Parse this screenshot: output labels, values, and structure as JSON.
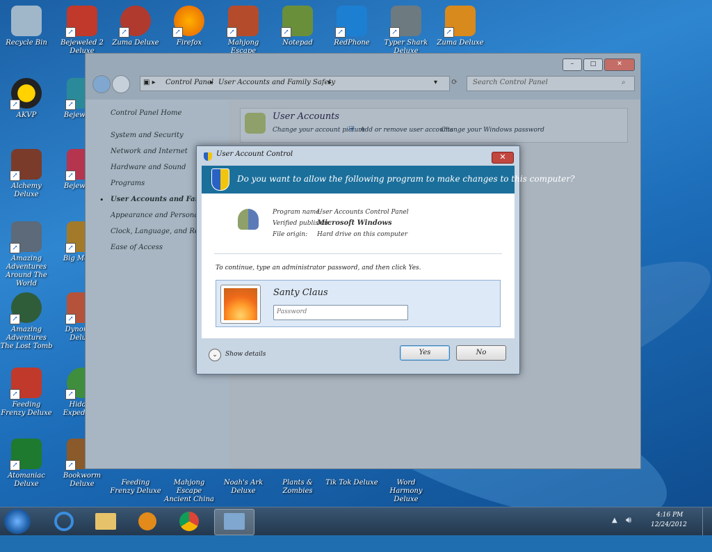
{
  "desktop": {
    "icons": [
      {
        "label": "Recycle Bin",
        "color": "#9fb7c9",
        "shortcut": false
      },
      {
        "label": "Bejeweled 2 Deluxe",
        "color": "#c0392b",
        "shortcut": true
      },
      {
        "label": "Zuma Deluxe",
        "color": "#b03a2e",
        "shortcut": true
      },
      {
        "label": "Firefox",
        "color": "#e66000",
        "shortcut": true
      },
      {
        "label": "Mahjong Escape",
        "color": "#b44c2c",
        "shortcut": true
      },
      {
        "label": "Notepad",
        "color": "#6a8f3a",
        "shortcut": true
      },
      {
        "label": "RedPhone",
        "color": "#1d7fd1",
        "shortcut": true
      },
      {
        "label": "Typer Shark Deluxe",
        "color": "#6d7a80",
        "shortcut": true
      },
      {
        "label": "Zuma Deluxe",
        "color": "#d88a1c",
        "shortcut": true
      },
      {
        "label": "AKVP",
        "color": "#222222",
        "shortcut": true
      },
      {
        "label": "Bejeweled",
        "color": "#2b8a99",
        "shortcut": true
      },
      {
        "label": "Alchemy Deluxe",
        "color": "#7a3b2a",
        "shortcut": true
      },
      {
        "label": "Bejeweled",
        "color": "#b5344e",
        "shortcut": true
      },
      {
        "label": "Amazing Adventures Around The World",
        "color": "#5c6a7a",
        "shortcut": true
      },
      {
        "label": "Big Money",
        "color": "#a37a2a",
        "shortcut": true
      },
      {
        "label": "Amazing Adventures The Lost Tomb",
        "color": "#2f5d3a",
        "shortcut": true
      },
      {
        "label": "Dynomite Deluxe",
        "color": "#b5533a",
        "shortcut": true
      },
      {
        "label": "Feeding Frenzy Deluxe",
        "color": "#c0392b",
        "shortcut": true
      },
      {
        "label": "Hidden Expedition",
        "color": "#3e8e3e",
        "shortcut": true
      },
      {
        "label": "Atomaniac Deluxe",
        "color": "#1e7a2e",
        "shortcut": true
      },
      {
        "label": "Bookworm Deluxe",
        "color": "#8a5a2a",
        "shortcut": true
      }
    ],
    "bottom_labels": [
      "Feeding Frenzy Deluxe",
      "Mahjong Escape Ancient China",
      "Noah's Ark Deluxe",
      "Plants & Zombies",
      "Tik Tok Deluxe",
      "Word Harmony Deluxe"
    ]
  },
  "control_panel": {
    "address": [
      "Control Panel",
      "User Accounts and Family Safety"
    ],
    "search_placeholder": "Search Control Panel",
    "left_nav": [
      "Control Panel Home",
      "System and Security",
      "Network and Internet",
      "Hardware and Sound",
      "Programs",
      "User Accounts and Family Safety",
      "Appearance and Personalization",
      "Clock, Language, and Region",
      "Ease of Access"
    ],
    "user_accounts": {
      "heading": "User Accounts",
      "link1": "Change your account picture",
      "link2": "Add or remove user accounts",
      "link3": "Change your Windows password"
    }
  },
  "uac": {
    "title": "User Account Control",
    "question": "Do you want to allow the following program to make changes to this computer?",
    "program_name_label": "Program name:",
    "program_name": "User Accounts Control Panel",
    "publisher_label": "Verified publisher:",
    "publisher": "Microsoft Windows",
    "origin_label": "File origin:",
    "origin": "Hard drive on this computer",
    "instruction": "To continue, type an administrator password, and then click Yes.",
    "username": "Santy Claus",
    "password_placeholder": "Password",
    "show_details": "Show details",
    "yes": "Yes",
    "no": "No",
    "colors": {
      "band": "#1b6f9b",
      "yes_border": "#3c7fb1"
    }
  },
  "tray": {
    "time": "4:16 PM",
    "date": "12/24/2012"
  }
}
